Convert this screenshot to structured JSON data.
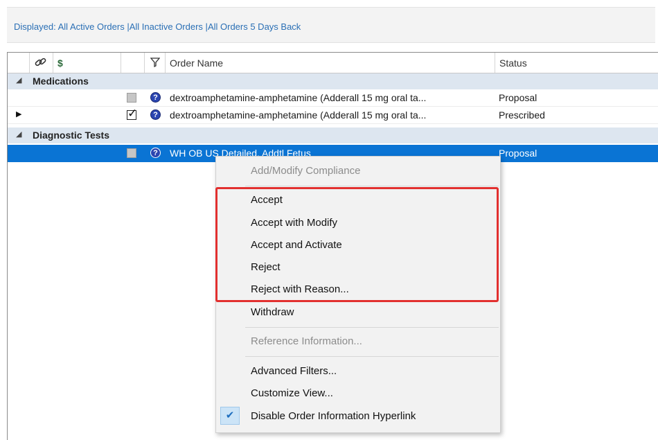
{
  "filter": {
    "prefix": "Displayed:",
    "links": [
      "All Active Orders",
      "All Inactive Orders",
      "All Orders 5 Days Back"
    ],
    "separator": "|"
  },
  "grid": {
    "headers": {
      "dollar": "$",
      "order_name": "Order Name",
      "status": "Status"
    },
    "groups": [
      {
        "label": "Medications"
      },
      {
        "label": "Diagnostic Tests"
      }
    ],
    "rows": [
      {
        "name": "dextroamphetamine-amphetamine (Adderall 15 mg oral ta...",
        "status": "Proposal"
      },
      {
        "name": "dextroamphetamine-amphetamine (Adderall 15 mg oral ta...",
        "status": "Prescribed"
      },
      {
        "name": "WH OB US Detailed, Addtl Fetus",
        "status": "Proposal"
      }
    ]
  },
  "context_menu": {
    "items": [
      {
        "label": "Add/Modify Compliance"
      },
      {
        "label": "Accept"
      },
      {
        "label": "Accept with Modify"
      },
      {
        "label": "Accept and Activate"
      },
      {
        "label": "Reject"
      },
      {
        "label": "Reject with Reason..."
      },
      {
        "label": "Withdraw"
      },
      {
        "label": "Reference Information..."
      },
      {
        "label": "Advanced Filters..."
      },
      {
        "label": "Customize View..."
      },
      {
        "label": "Disable Order Information Hyperlink"
      }
    ]
  },
  "colors": {
    "link": "#2a6fb5",
    "selection": "#0a74d4",
    "highlight_box": "#e2302f"
  }
}
